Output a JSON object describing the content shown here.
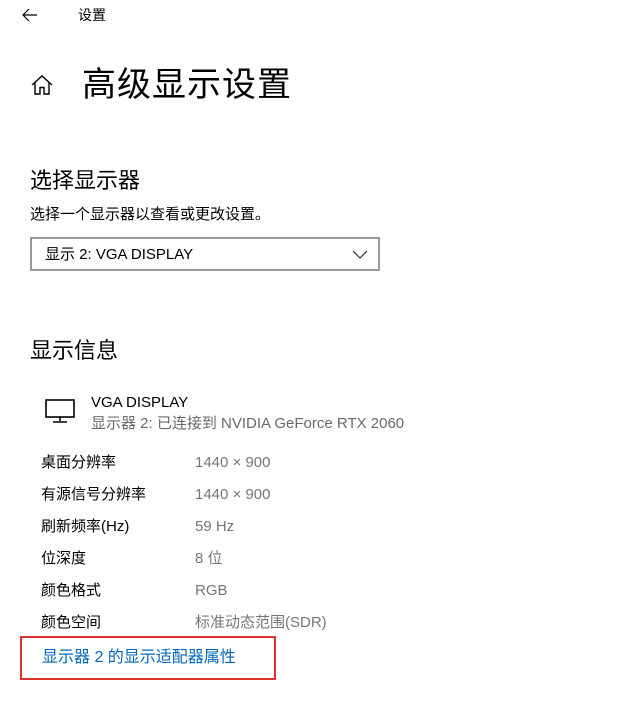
{
  "window": {
    "title": "设置"
  },
  "header": {
    "title": "高级显示设置"
  },
  "select_display": {
    "heading": "选择显示器",
    "description": "选择一个显示器以查看或更改设置。",
    "selected": "显示 2: VGA DISPLAY"
  },
  "display_info": {
    "heading": "显示信息",
    "name": "VGA DISPLAY",
    "subtitle": "显示器 2: 已连接到 NVIDIA GeForce RTX 2060",
    "rows": [
      {
        "label": "桌面分辨率",
        "value": "1440 × 900"
      },
      {
        "label": "有源信号分辨率",
        "value": "1440 × 900"
      },
      {
        "label": "刷新频率(Hz)",
        "value": "59 Hz"
      },
      {
        "label": "位深度",
        "value": "8 位"
      },
      {
        "label": "颜色格式",
        "value": "RGB"
      },
      {
        "label": "颜色空间",
        "value": "标准动态范围(SDR)"
      }
    ],
    "adapter_link": "显示器 2 的显示适配器属性"
  },
  "colors": {
    "link": "#0067b8",
    "highlight_border": "#e0302c",
    "secondary_text": "#767676"
  },
  "icons": {
    "back": "back-arrow-icon",
    "home": "home-icon",
    "dropdown": "chevron-down-icon",
    "monitor": "monitor-icon"
  }
}
